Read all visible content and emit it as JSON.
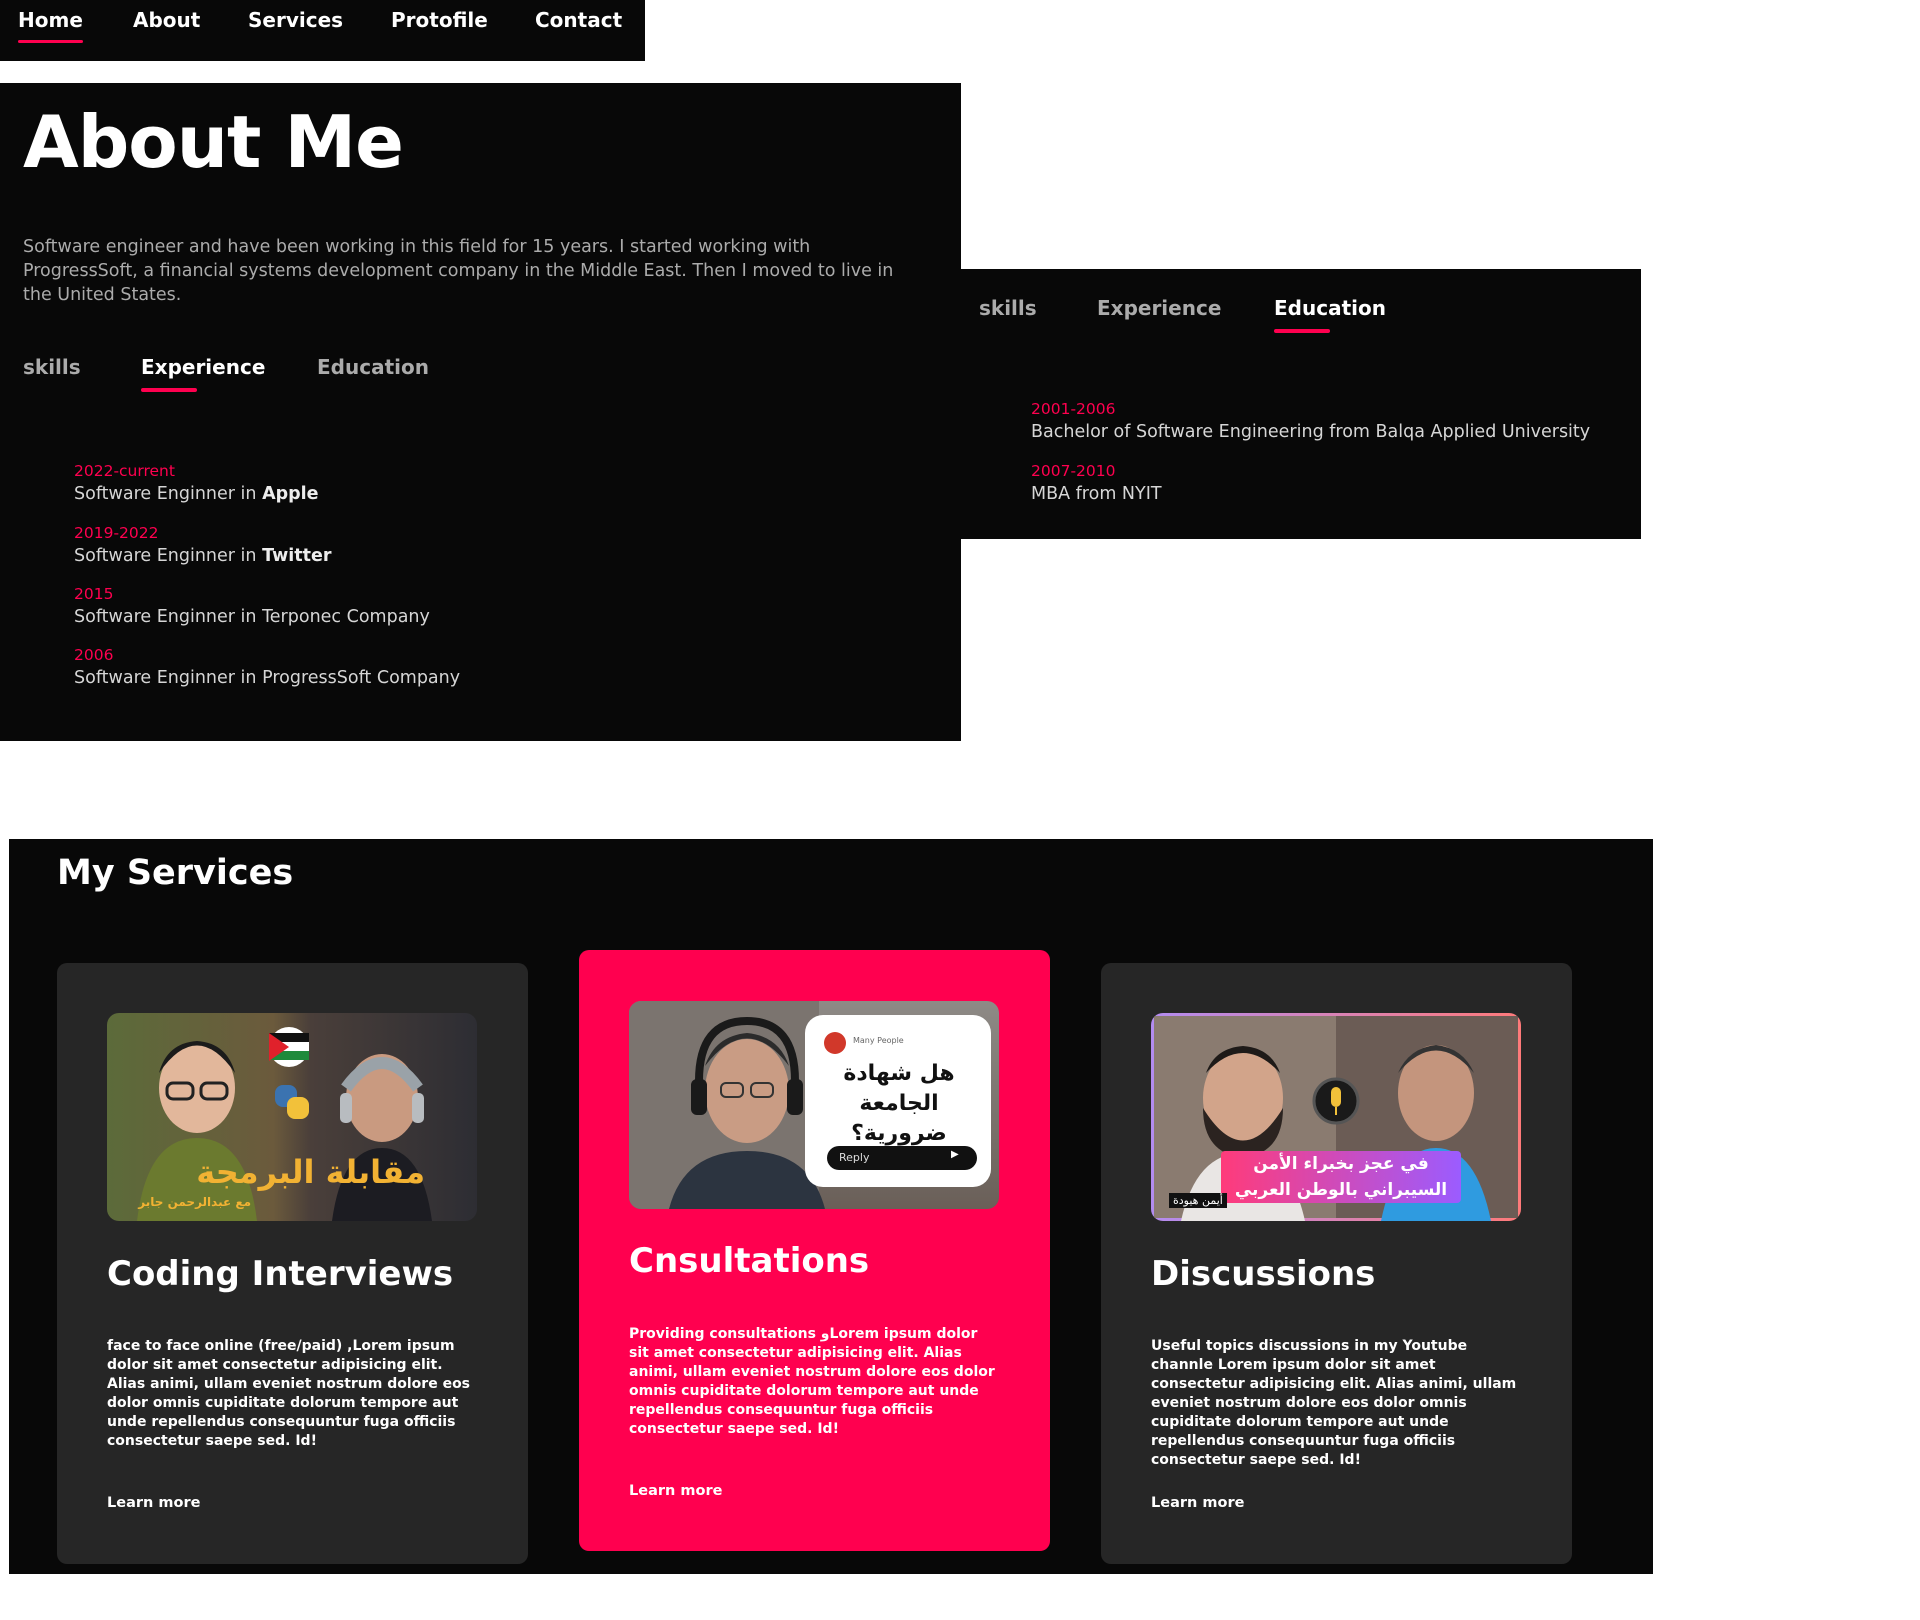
{
  "nav": {
    "items": [
      "Home",
      "About",
      "Services",
      "Protofile",
      "Contact"
    ],
    "active": "Home"
  },
  "about": {
    "title": "About Me",
    "text": "Software engineer and have been working in this field for 15 years. I started working with ProgressSoft, a financial systems development company in the Middle East. Then I moved to live in the United States.",
    "tabs": [
      "skills",
      "Experience",
      "Education"
    ],
    "active_tab": "Experience",
    "experience": [
      {
        "year": "2022-current",
        "role": "Software Enginner in",
        "org": "Apple",
        "org_bold": true
      },
      {
        "year": "2019-2022",
        "role": "Software Enginner in",
        "org": "Twitter",
        "org_bold": true
      },
      {
        "year": "2015",
        "role": "Software Enginner in",
        "org": "Terponec Company",
        "org_bold": false
      },
      {
        "year": "2006",
        "role": "Software Enginner in",
        "org": "ProgressSoft Company",
        "org_bold": false
      }
    ]
  },
  "education_panel": {
    "tabs": [
      "skills",
      "Experience",
      "Education"
    ],
    "active_tab": "Education",
    "entries": [
      {
        "year": "2001-2006",
        "text": "Bachelor of Software Engineering from Balqa Applied University"
      },
      {
        "year": "2007-2010",
        "text": "MBA from NYIT"
      }
    ]
  },
  "services": {
    "title": "My Services",
    "cards": [
      {
        "title": "Coding Interviews",
        "text": "face to face online (free/paid) ,Lorem ipsum dolor sit amet consectetur adipisicing elit. Alias animi, ullam eveniet nostrum dolore eos dolor omnis cupiditate dolorum tempore aut unde repellendus consequuntur fuga officiis consectetur saepe sed. Id!",
        "link": "Learn more",
        "thumb_text": "مقابلة البرمجة",
        "thumb_sub": "مع عبدالرحمن جابر",
        "highlighted": false
      },
      {
        "title": "Cnsultations",
        "text": "Providing consultations وLorem ipsum dolor sit amet consectetur adipisicing elit. Alias animi, ullam eveniet nostrum dolore eos dolor omnis cupiditate dolorum tempore aut unde repellendus consequuntur fuga officiis consectetur saepe sed. Id!",
        "link": "Learn more",
        "thumb_text": "هل شهادة الجامعة ضرورية؟",
        "thumb_sub": "Many People",
        "thumb_reply": "Reply",
        "highlighted": true
      },
      {
        "title": "Discussions",
        "text": "Useful topics discussions in my Youtube channle Lorem ipsum dolor sit amet consectetur adipisicing elit. Alias animi, ullam eveniet nostrum dolore eos dolor omnis cupiditate dolorum tempore aut unde repellendus consequuntur fuga officiis consectetur saepe sed. Id!",
        "link": "Learn more",
        "thumb_text": "في عجز بخبراء الأمن السيبراني بالوطن العربي",
        "thumb_sub": "أيمن هيودة",
        "highlighted": false
      }
    ]
  },
  "colors": {
    "accent": "#ff004f",
    "bg": "#080808",
    "card": "#262626",
    "text_muted": "#ababab"
  }
}
